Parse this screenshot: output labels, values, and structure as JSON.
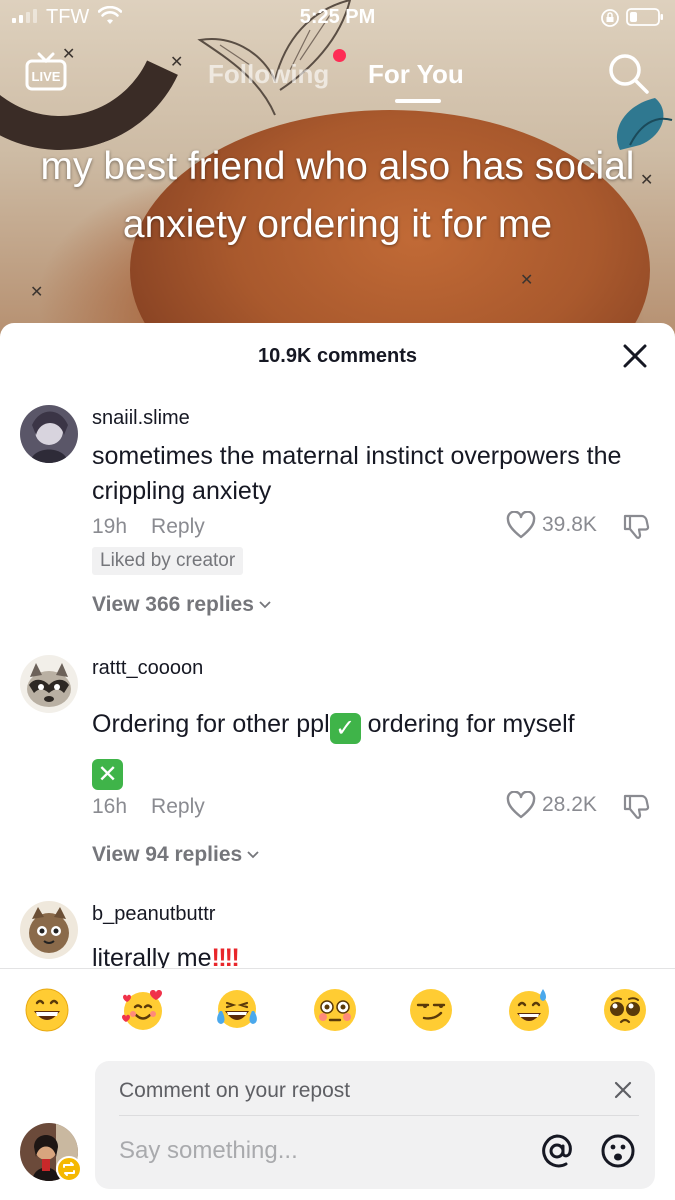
{
  "status_bar": {
    "carrier": "TFW",
    "time": "5:25 PM"
  },
  "nav": {
    "following": "Following",
    "for_you": "For You",
    "live": "LIVE"
  },
  "caption": "my best friend who also has social anxiety ordering it for me",
  "comments_sheet": {
    "count_label": "10.9K comments",
    "comments": [
      {
        "username": "snaiil.slime",
        "text": "sometimes the maternal instinct overpowers the crippling anxiety",
        "time": "19h",
        "reply_label": "Reply",
        "likes": "39.8K",
        "badge": "Liked by creator",
        "view_replies": "View 366 replies"
      },
      {
        "username": "rattt_coooon",
        "text_before": "Ordering for other ppl",
        "emoji_1": "✓",
        "text_after": " ordering for myself",
        "emoji_2": "✕",
        "time": "16h",
        "reply_label": "Reply",
        "likes": "28.2K",
        "view_replies": "View 94 replies"
      },
      {
        "username": "b_peanutbuttr",
        "text": "literally me",
        "text_suffix": "‼‼"
      }
    ]
  },
  "emoji_bar": [
    "grinning-face",
    "smiling-face-with-hearts",
    "tears-of-joy",
    "flushed-face",
    "smirking-face",
    "grinning-sweat",
    "pleading-face"
  ],
  "comment_input": {
    "repost_label": "Comment on your repost",
    "placeholder": "Say something..."
  },
  "colors": {
    "accent_red": "#fe2c55",
    "text_primary": "#161823",
    "text_secondary": "#8a8b91",
    "check_green": "#3fb449"
  }
}
